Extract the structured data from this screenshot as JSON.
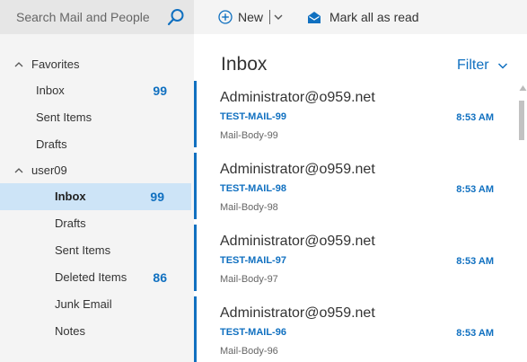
{
  "search": {
    "placeholder": "Search Mail and People"
  },
  "toolbar": {
    "new_label": "New",
    "mark_all_read_label": "Mark all as read"
  },
  "favorites": {
    "label": "Favorites",
    "items": [
      {
        "label": "Inbox",
        "count": "99"
      },
      {
        "label": "Sent Items",
        "count": ""
      },
      {
        "label": "Drafts",
        "count": ""
      }
    ]
  },
  "account": {
    "label": "user09",
    "items": [
      {
        "label": "Inbox",
        "count": "99",
        "selected": true
      },
      {
        "label": "Drafts",
        "count": ""
      },
      {
        "label": "Sent Items",
        "count": ""
      },
      {
        "label": "Deleted Items",
        "count": "86"
      },
      {
        "label": "Junk Email",
        "count": ""
      },
      {
        "label": "Notes",
        "count": ""
      }
    ]
  },
  "list": {
    "title": "Inbox",
    "filter_label": "Filter",
    "messages": [
      {
        "sender": "Administrator@o959.net",
        "subject": "TEST-MAIL-99",
        "time": "8:53 AM",
        "preview": "Mail-Body-99"
      },
      {
        "sender": "Administrator@o959.net",
        "subject": "TEST-MAIL-98",
        "time": "8:53 AM",
        "preview": "Mail-Body-98"
      },
      {
        "sender": "Administrator@o959.net",
        "subject": "TEST-MAIL-97",
        "time": "8:53 AM",
        "preview": "Mail-Body-97"
      },
      {
        "sender": "Administrator@o959.net",
        "subject": "TEST-MAIL-96",
        "time": "8:53 AM",
        "preview": "Mail-Body-96"
      }
    ]
  },
  "colors": {
    "accent": "#1070c0",
    "nav_bg": "#f4f4f4",
    "selected_bg": "#cde4f7"
  },
  "icons": {
    "search": "search-icon",
    "new": "plus-circle-icon",
    "mark_read": "envelope-open-icon"
  }
}
